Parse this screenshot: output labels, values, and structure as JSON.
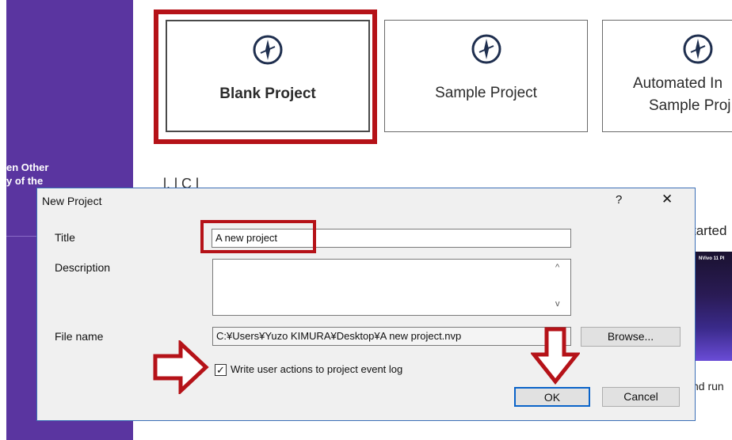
{
  "sidebar": {
    "line1": "en Other",
    "line2": "y of the"
  },
  "cards": [
    {
      "label": "Blank Project"
    },
    {
      "label": "Sample Project"
    },
    {
      "label_line1": "Automated In",
      "label_line2": "Sample Proj"
    }
  ],
  "background": {
    "heading_cut": "l.         l  C          l",
    "started_cut": "tarted",
    "thumb_caption": "NVivo 11 Pl",
    "run_cut": "nd run"
  },
  "dialog": {
    "title": "New Project",
    "help": "?",
    "close": "✕",
    "title_label": "Title",
    "title_value": "A new project",
    "description_label": "Description",
    "description_value": "",
    "filename_label": "File name",
    "filename_value": "C:¥Users¥Yuzo KIMURA¥Desktop¥A new project.nvp",
    "browse_label": "Browse...",
    "log_checkbox_label": "Write user actions to project event log",
    "log_checked": true,
    "ok_label": "OK",
    "cancel_label": "Cancel"
  },
  "colors": {
    "sidebar": "#5a35a0",
    "highlight_red": "#b51218",
    "dialog_border": "#3b6fb6",
    "icon_navy": "#1f2f4f"
  }
}
